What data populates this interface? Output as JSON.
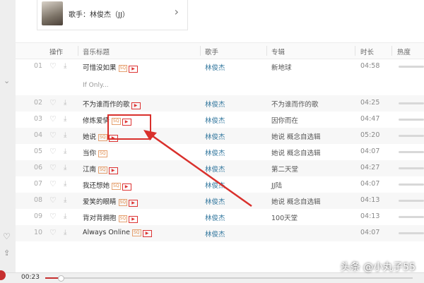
{
  "artist_card": {
    "label": "歌手：林俊杰（JJ）"
  },
  "columns": {
    "action": "操作",
    "title": "音乐标题",
    "artist": "歌手",
    "album": "专辑",
    "duration": "时长",
    "heat": "热度"
  },
  "songs": [
    {
      "num": "01",
      "title": "可惜没如果",
      "artist": "林俊杰",
      "album": "新地球",
      "duration": "04:58",
      "sq": "SQ",
      "mv": "▶"
    },
    {
      "num": "02",
      "title": "不为谁而作的歌",
      "artist": "林俊杰",
      "album": "不为谁而作的歌",
      "duration": "04:25",
      "sq": "",
      "mv": "▶"
    },
    {
      "num": "03",
      "title": "修炼爱情",
      "artist": "林俊杰",
      "album": "因你而在",
      "duration": "04:47",
      "sq": "SQ",
      "mv": "▶"
    },
    {
      "num": "04",
      "title": "她说",
      "artist": "林俊杰",
      "album": "她说 概念自选辑",
      "duration": "05:20",
      "sq": "SQ",
      "mv": "▶"
    },
    {
      "num": "05",
      "title": "当你",
      "artist": "林俊杰",
      "album": "她说 概念自选辑",
      "duration": "04:07",
      "sq": "SQ",
      "mv": ""
    },
    {
      "num": "06",
      "title": "江南",
      "artist": "林俊杰",
      "album": "第二天堂",
      "duration": "04:27",
      "sq": "SQ",
      "mv": "▶"
    },
    {
      "num": "07",
      "title": "我还想她",
      "artist": "林俊杰",
      "album": "JJ陆",
      "duration": "04:07",
      "sq": "SQ",
      "mv": "▶"
    },
    {
      "num": "08",
      "title": "爱笑的眼睛",
      "artist": "林俊杰",
      "album": "她说 概念自选辑",
      "duration": "04:13",
      "sq": "SQ",
      "mv": "▶"
    },
    {
      "num": "09",
      "title": "背对背拥抱",
      "artist": "林俊杰",
      "album": "100天堂",
      "duration": "04:13",
      "sq": "SQ",
      "mv": "▶"
    },
    {
      "num": "10",
      "title": "Always Online",
      "artist": "林俊杰",
      "album": "",
      "duration": "04:07",
      "sq": "SQ",
      "mv": "▶"
    }
  ],
  "sub_line": "If Only...",
  "player": {
    "current_time": "00:23",
    "progress": 0.04
  },
  "watermark": "头条 @小丸子55",
  "icons": {
    "like": "heart-icon",
    "download": "download-icon",
    "mv": "mv-play-icon",
    "sq": "sq-badge"
  },
  "colors": {
    "artist_link": "#31769d",
    "annotation": "#d9302c",
    "accent": "#c62f2f"
  }
}
